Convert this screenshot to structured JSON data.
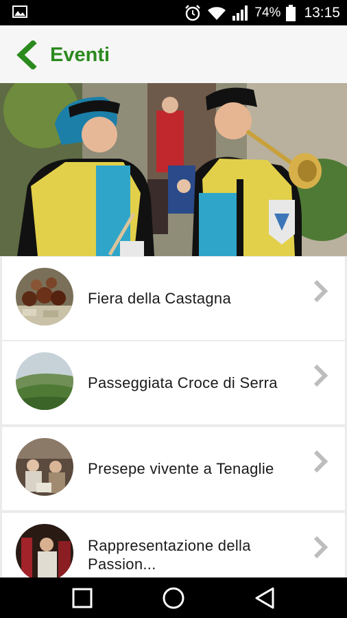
{
  "status_bar": {
    "battery_percent": "74%",
    "time": "13:15",
    "icons": [
      "gallery-icon",
      "alarm-icon",
      "wifi-icon",
      "signal-icon",
      "battery-icon"
    ]
  },
  "app_bar": {
    "title": "Eventi",
    "back_icon": "chevron-left-icon",
    "accent_color": "#2b8a1e"
  },
  "hero_image": {
    "subject": "costumed medieval pageant musicians"
  },
  "events": [
    {
      "title": "Fiera della Castagna",
      "thumb": "chestnuts"
    },
    {
      "title": "Passeggiata Croce di Serra",
      "thumb": "green-hills"
    },
    {
      "title": "Presepe vivente a Tenaglie",
      "thumb": "nativity-scene"
    },
    {
      "title": "Rappresentazione della Passion...",
      "thumb": "passion-play"
    }
  ],
  "nav_bar": {
    "icons": [
      "recents-square-icon",
      "home-circle-icon",
      "back-triangle-icon"
    ]
  }
}
